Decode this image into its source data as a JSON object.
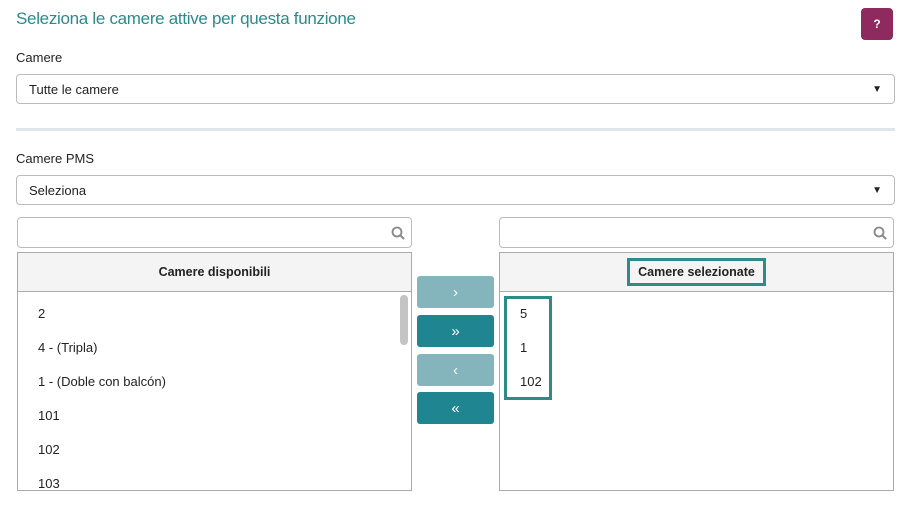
{
  "title": "Seleziona le camere attive per questa funzione",
  "help_label": "?",
  "camere": {
    "label": "Camere",
    "value": "Tutte le camere"
  },
  "pms": {
    "label": "Camere PMS",
    "value": "Seleziona"
  },
  "available": {
    "search_placeholder": "",
    "header": "Camere disponibili",
    "items": [
      "2",
      "4 - (Tripla)",
      "1 - (Doble con balcón)",
      "101",
      "102",
      "103"
    ]
  },
  "selected": {
    "search_placeholder": "",
    "header": "Camere selezionate",
    "items": [
      "5",
      "1",
      "102"
    ]
  },
  "buttons": {
    "move_right": "›",
    "move_all_right": "»",
    "move_left": "‹",
    "move_all_left": "«"
  },
  "colors": {
    "accent": "#2a8a8c",
    "help": "#8e2a5e",
    "button_dark": "#1e8591",
    "button_light": "#84b5bd"
  }
}
